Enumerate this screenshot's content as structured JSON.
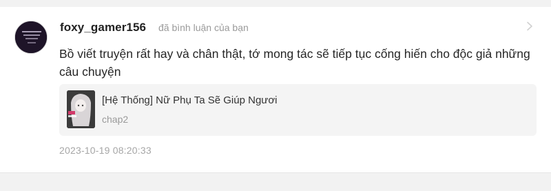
{
  "comment": {
    "username": "foxy_gamer156",
    "action_text": "đã bình luận của bạn",
    "text": "Bồ viết truyện rất hay và chân thật, tớ mong tác sẽ tiếp tục cống hiến cho độc giả những câu chuyện",
    "timestamp": "2023-10-19 08:20:33",
    "avatar_icon": "user-avatar",
    "chevron_icon": "chevron-right-icon"
  },
  "story": {
    "title": "[Hệ Thống] Nữ Phụ Ta Sẽ Giúp Ngươi",
    "chapter": "chap2",
    "cover_icon": "story-cover-image"
  },
  "colors": {
    "background": "#f2f2f2",
    "card": "#ffffff",
    "story_card": "#f4f4f4",
    "muted_text": "#9a9a9a"
  }
}
